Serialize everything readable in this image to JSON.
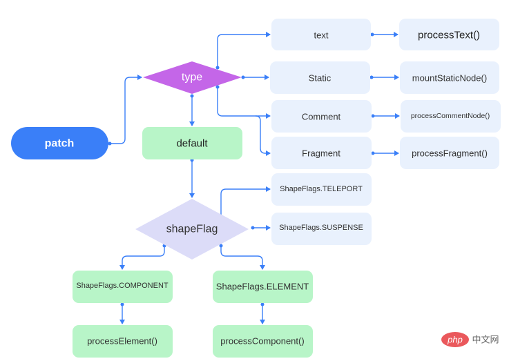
{
  "colors": {
    "connector": "#3a7ff8",
    "start": "#3a7ff8",
    "decision_type": "#c466e8",
    "decision_shapeflag": "#dcdcf8",
    "branch": "#e9f1fd",
    "default": "#b8f5c8"
  },
  "nodes": {
    "patch": "patch",
    "type": "type",
    "default": "default",
    "text": "text",
    "processText": "processText()",
    "static": "Static",
    "mountStaticNode": "mountStaticNode()",
    "comment": "Comment",
    "processCommentNode": "processCommentNode()",
    "fragment": "Fragment",
    "processFragment": "processFragment()",
    "shapeFlag": "shapeFlag",
    "teleport": "ShapeFlags.TELEPORT",
    "suspense": "ShapeFlags.SUSPENSE",
    "component": "ShapeFlags.COMPONENT",
    "element": "ShapeFlags.ELEMENT",
    "processElement": "processElement()",
    "processComponent": "processComponent()"
  },
  "watermark": {
    "logo": "php",
    "text": "中文网"
  }
}
